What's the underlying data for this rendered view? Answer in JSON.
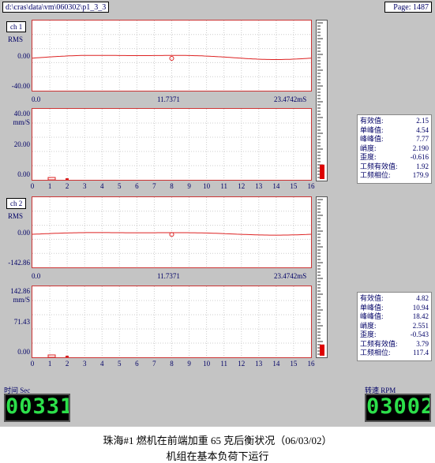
{
  "header": {
    "file_path": "d:\\cras\\data\\vm\\060302\\p1_3_3",
    "page": "Page:  1487"
  },
  "ch1": {
    "label": "ch 1",
    "rms": "RMS",
    "wave": {
      "y_top": "",
      "y_mid": "0.00",
      "y_bot": "-40.00",
      "x_start": "0.0",
      "x_mid": "11.7371",
      "x_end": "23.4742mS"
    },
    "spectrum": {
      "y_top": "40.00",
      "unit": "mm/S",
      "y_mid": "20.00",
      "y_bot": "0.00"
    }
  },
  "ch2": {
    "label": "ch 2",
    "rms": "RMS",
    "wave": {
      "y_top": "",
      "y_mid": "0.00",
      "y_bot": "-142.86",
      "x_start": "0.0",
      "x_mid": "11.7371",
      "x_end": "23.4742mS"
    },
    "spectrum": {
      "y_top": "142.86",
      "unit": "mm/S",
      "y_mid": "71.43",
      "y_bot": "0.00"
    }
  },
  "x_ticks": [
    "0",
    "1",
    "2",
    "3",
    "4",
    "5",
    "6",
    "7",
    "8",
    "9",
    "10",
    "11",
    "12",
    "13",
    "14",
    "15",
    "16"
  ],
  "stats1": [
    {
      "label": "有效值:",
      "value": "2.15"
    },
    {
      "label": "单峰值:",
      "value": "4.54"
    },
    {
      "label": "峰峰值:",
      "value": "7.77"
    },
    {
      "label": "峭度:",
      "value": "2.190"
    },
    {
      "label": "歪度:",
      "value": "-0.616"
    },
    {
      "label": "工频有效值:",
      "value": "1.92"
    },
    {
      "label": "工频相位:",
      "value": "179.9"
    }
  ],
  "stats2": [
    {
      "label": "有效值:",
      "value": "4.82"
    },
    {
      "label": "单峰值:",
      "value": "10.94"
    },
    {
      "label": "峰峰值:",
      "value": "18.42"
    },
    {
      "label": "峭度:",
      "value": "2.551"
    },
    {
      "label": "歪度:",
      "value": "-0.543"
    },
    {
      "label": "工频有效值:",
      "value": "3.79"
    },
    {
      "label": "工频相位:",
      "value": "117.4"
    }
  ],
  "meters": {
    "ch1_level": 0.09,
    "ch2_level": 0.07
  },
  "time": {
    "label": "时间 Sec",
    "value": "003311"
  },
  "speed": {
    "label": "转速 RPM",
    "value": "03002"
  },
  "caption": {
    "line1": "珠海#1 燃机在前端加重 65 克后衡状况（06/03/02）",
    "line2": "机组在基本负荷下运行"
  },
  "colors": {
    "background": "#c4c4c4",
    "trace": "#dd2222",
    "text": "#000066",
    "digits": "#2ce04a"
  }
}
